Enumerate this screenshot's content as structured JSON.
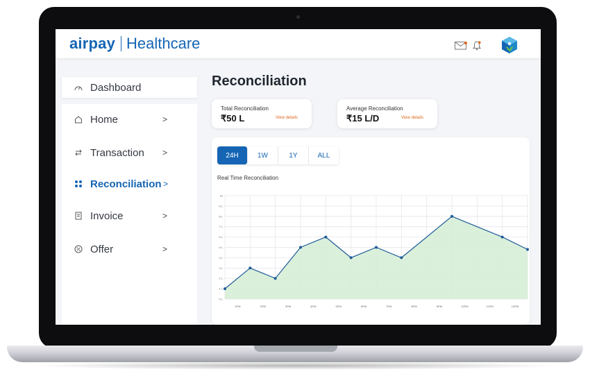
{
  "header": {
    "brand": "airpay",
    "product": "Healthcare",
    "icons": [
      "mail-icon",
      "bell-icon",
      "brand-cube-icon"
    ],
    "notification_dot_color": "#e0681d"
  },
  "sidebar": {
    "dashboard": {
      "label": "Dashboard",
      "icon": "speedometer-icon"
    },
    "items": [
      {
        "label": "Home",
        "icon": "home-icon",
        "chevron": ">"
      },
      {
        "label": "Transaction",
        "icon": "transfer-icon",
        "chevron": ">"
      },
      {
        "label": "Reconciliation",
        "icon": "reconcile-icon",
        "chevron": ">",
        "active": true
      },
      {
        "label": "Invoice",
        "icon": "invoice-icon",
        "chevron": ">"
      },
      {
        "label": "Offer",
        "icon": "offer-icon",
        "chevron": ">"
      }
    ]
  },
  "main": {
    "title": "Reconciliation",
    "kpis": [
      {
        "title": "Total Reconciliation",
        "value": "₹50 L",
        "link": "View details"
      },
      {
        "title": "Average Reconciliation",
        "value": "₹15 L/D",
        "link": "View details"
      }
    ],
    "tabs": [
      "24H",
      "1W",
      "1Y",
      "ALL"
    ],
    "active_tab": "24H"
  },
  "chart_data": {
    "type": "area",
    "title": "Real Time Reconciliation",
    "x": [
      "12PM",
      "1PM",
      "2PM",
      "3PM",
      "4PM",
      "5PM",
      "6PM",
      "7PM",
      "8PM",
      "9PM",
      "10PM",
      "11PM",
      "12PM"
    ],
    "x_tick_labels": [
      "1PM",
      "2PM",
      "3PM",
      "4PM",
      "5PM",
      "6PM",
      "7PM",
      "8PM",
      "9PM",
      "10PM",
      "11PM",
      "12PM"
    ],
    "values": [
      1,
      3,
      2,
      5,
      6,
      4,
      5,
      4,
      6,
      8,
      7,
      6,
      4.8
    ],
    "marked_points": [
      0,
      1,
      2,
      3,
      4,
      5,
      6,
      7,
      9,
      11,
      12
    ],
    "y_ticks": [
      "0 L",
      "1 L",
      "2 L",
      "3 L",
      "4 L",
      "5 L",
      "6 L",
      "7 L",
      "8 L",
      "9 L",
      "10"
    ],
    "ylim": [
      0,
      10
    ],
    "grid": true,
    "line_color": "#1f5b9a",
    "fill_color": "#d4edd4"
  },
  "colors": {
    "accent": "#1565b4",
    "link": "#e0681d",
    "background": "#f4f5f8"
  }
}
